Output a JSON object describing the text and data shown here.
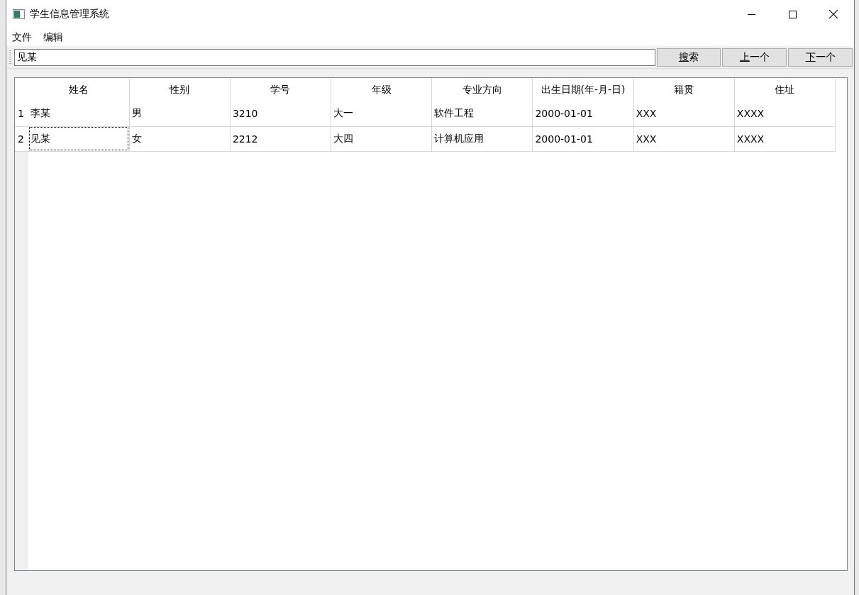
{
  "window": {
    "title": "学生信息管理系统"
  },
  "menu": [
    "文件",
    "编辑"
  ],
  "search": {
    "value": "见某"
  },
  "buttons": [
    {
      "label": "搜索",
      "shortcut_underlined": true
    },
    {
      "label": "上一个",
      "shortcut_underlined": true
    },
    {
      "label": "下一个",
      "shortcut_underlined": true
    }
  ],
  "table": {
    "columns": [
      "姓名",
      "性别",
      "学号",
      "年级",
      "专业方向",
      "出生日期(年-月-日)",
      "籍贯",
      "住址"
    ],
    "rows": [
      {
        "number": "1",
        "cells": [
          {
            "text": "李某",
            "focused": false
          },
          {
            "text": "男",
            "focused": false
          },
          {
            "text": "3210",
            "focused": false
          },
          {
            "text": "大一",
            "focused": false
          },
          {
            "text": "软件工程",
            "focused": false
          },
          {
            "text": "2000-01-01",
            "focused": false
          },
          {
            "text": "XXX",
            "focused": false
          },
          {
            "text": "XXXX",
            "focused": false
          }
        ]
      },
      {
        "number": "2",
        "cells": [
          {
            "text": "见某",
            "focused": true
          },
          {
            "text": "女",
            "focused": false
          },
          {
            "text": "2212",
            "focused": false
          },
          {
            "text": "大四",
            "focused": false
          },
          {
            "text": "计算机应用",
            "focused": false
          },
          {
            "text": "2000-01-01",
            "focused": false
          },
          {
            "text": "XXX",
            "focused": false
          },
          {
            "text": "XXXX",
            "focused": false
          }
        ]
      }
    ]
  }
}
